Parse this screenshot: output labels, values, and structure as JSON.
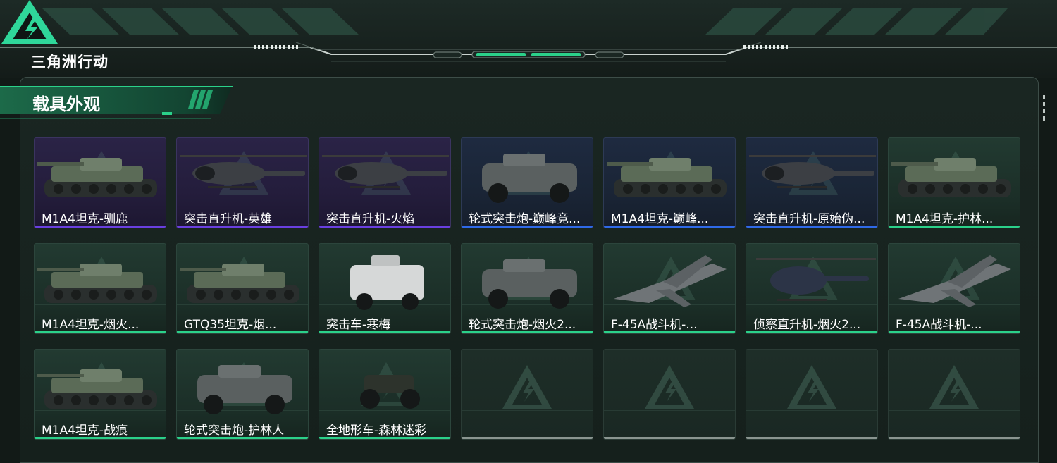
{
  "app": {
    "logo_text": "三角洲行动"
  },
  "section": {
    "title": "载具外观"
  },
  "colors": {
    "accent_green": "#2bd18a",
    "rare_purple": "#6a3fe0",
    "rare_blue": "#2f69e8",
    "empty_grey": "#8a9590"
  },
  "cards": [
    {
      "label": "M1A4坦克-驯鹿",
      "rarity": "purple",
      "icon": "tank-icon"
    },
    {
      "label": "突击直升机-英雄",
      "rarity": "purple",
      "icon": "helicopter-icon"
    },
    {
      "label": "突击直升机-火焰",
      "rarity": "purple",
      "icon": "helicopter-icon"
    },
    {
      "label": "轮式突击炮-巅峰竞...",
      "rarity": "blue",
      "icon": "armored-car-icon"
    },
    {
      "label": "M1A4坦克-巅峰...",
      "rarity": "blue",
      "icon": "tank-icon"
    },
    {
      "label": "突击直升机-原始伪...",
      "rarity": "blue",
      "icon": "helicopter-icon"
    },
    {
      "label": "M1A4坦克-护林...",
      "rarity": "green",
      "icon": "tank-icon"
    },
    {
      "label": "M1A4坦克-烟火...",
      "rarity": "green",
      "icon": "tank-icon"
    },
    {
      "label": "GTQ35坦克-烟...",
      "rarity": "green",
      "icon": "tank-icon"
    },
    {
      "label": "突击车-寒梅",
      "rarity": "green",
      "icon": "assault-vehicle-icon"
    },
    {
      "label": "轮式突击炮-烟火2...",
      "rarity": "green",
      "icon": "armored-car-icon"
    },
    {
      "label": "F-45A战斗机-...",
      "rarity": "green",
      "icon": "jet-icon"
    },
    {
      "label": "侦察直升机-烟火2...",
      "rarity": "green",
      "icon": "scout-helicopter-icon"
    },
    {
      "label": "F-45A战斗机-...",
      "rarity": "green",
      "icon": "jet-icon"
    },
    {
      "label": "M1A4坦克-战痕",
      "rarity": "green",
      "icon": "tank-icon"
    },
    {
      "label": "轮式突击炮-护林人",
      "rarity": "green",
      "icon": "armored-car-icon"
    },
    {
      "label": "全地形车-森林迷彩",
      "rarity": "green",
      "icon": "atv-icon"
    },
    {
      "label": "",
      "rarity": "grey",
      "icon": "empty-slot-icon"
    },
    {
      "label": "",
      "rarity": "grey",
      "icon": "empty-slot-icon"
    },
    {
      "label": "",
      "rarity": "grey",
      "icon": "empty-slot-icon"
    },
    {
      "label": "",
      "rarity": "grey",
      "icon": "empty-slot-icon"
    }
  ]
}
